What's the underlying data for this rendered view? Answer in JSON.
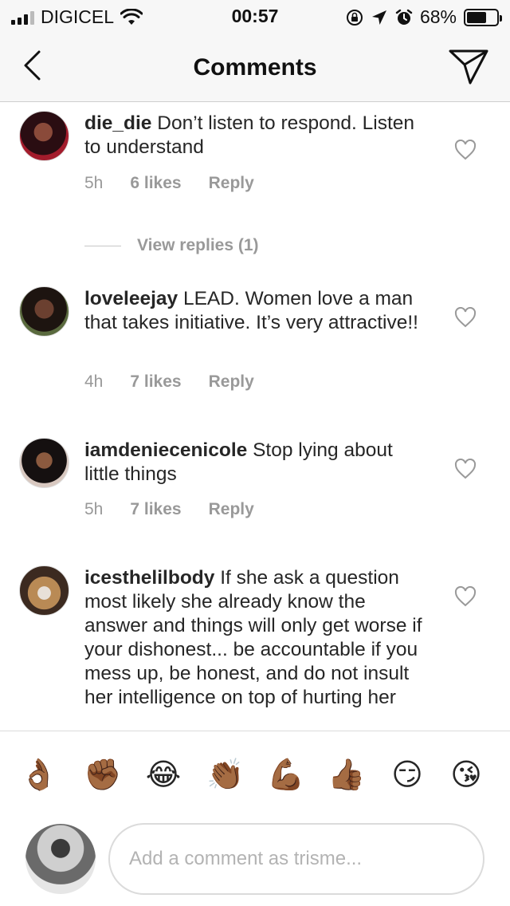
{
  "status_bar": {
    "carrier": "DIGICEL",
    "time": "00:57",
    "battery_percent": "68%",
    "battery_level": 0.68,
    "icons": [
      "signal-icon",
      "wifi-icon",
      "rotation-lock-icon",
      "location-icon",
      "alarm-icon",
      "battery-icon"
    ]
  },
  "header": {
    "title": "Comments",
    "back_icon": "chevron-left-icon",
    "send_icon": "paper-plane-icon"
  },
  "comments": [
    {
      "username": "die_die",
      "text": " Don’t listen to respond. Listen to understand",
      "time": "5h",
      "likes": "6 likes",
      "reply": "Reply",
      "view_replies": "View replies (1)"
    },
    {
      "username": "loveleejay",
      "text": " LEAD. Women love a man that takes initiative. It’s very attractive!!",
      "time": "4h",
      "likes": "7 likes",
      "reply": "Reply"
    },
    {
      "username": "iamdeniecenicole",
      "text": " Stop lying about little things",
      "time": "5h",
      "likes": "7 likes",
      "reply": "Reply"
    },
    {
      "username": "icesthelilbody",
      "text": " If she ask a question most likely she already know the answer and things will only get worse if your dishonest... be accountable if you mess up, be honest, and do not insult her intelligence on top of hurting her"
    }
  ],
  "emoji_bar": [
    "👌🏾",
    "✊🏾",
    "😂",
    "👏🏾",
    "💪🏾",
    "👍🏾",
    "😏",
    "😘"
  ],
  "comment_input": {
    "placeholder": "Add a comment as trisme..."
  },
  "colors": {
    "header_bg": "#f7f7f7",
    "text": "#262626",
    "muted": "#999999",
    "border": "#dbdbdb"
  }
}
